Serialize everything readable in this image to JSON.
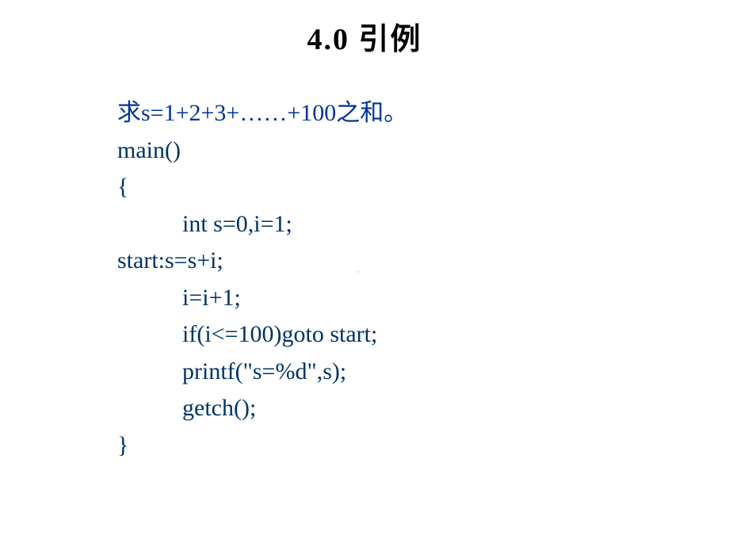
{
  "title": "4.0 引例",
  "problem": "求s=1+2+3+……+100之和。",
  "code": {
    "line1": "main()",
    "line2": "{",
    "line3": "int s=0,i=1;",
    "line4": "start:s=s+i;",
    "line5": "i=i+1;",
    "line6": "if(i<=100)goto start;",
    "line7": "printf(\"s=%d\",s);",
    "line8": "getch();",
    "line9": "}"
  },
  "watermark": "."
}
